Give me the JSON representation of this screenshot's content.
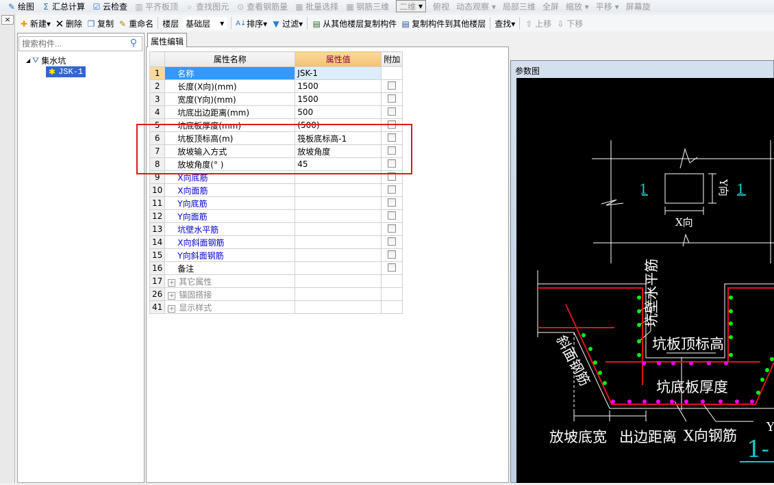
{
  "toolbar_top": {
    "items": [
      {
        "label": "绘图",
        "enabled": true
      },
      {
        "label": "汇总计算",
        "enabled": true
      },
      {
        "label": "云检查",
        "enabled": true
      },
      {
        "label": "平齐板顶",
        "enabled": false
      },
      {
        "label": "查找图元",
        "enabled": false
      },
      {
        "label": "查看钢筋量",
        "enabled": false
      },
      {
        "label": "批量选择",
        "enabled": false
      },
      {
        "label": "钢筋三维",
        "enabled": false
      }
    ],
    "view_combo": "二维",
    "view_items": [
      "俯视",
      "动态观察",
      "局部三维",
      "全屏",
      "缩放",
      "平移",
      "屏幕旋"
    ]
  },
  "toolbar": {
    "new": "新建",
    "delete": "删除",
    "copy": "复制",
    "rename": "重命名",
    "floor_label": "楼层",
    "floor_value": "基础层",
    "sort": "排序",
    "filter": "过滤",
    "copy_from": "从其他楼层复制构件",
    "copy_to": "复制构件到其他楼层",
    "find": "查找",
    "move_up": "上移",
    "move_down": "下移"
  },
  "left": {
    "search_placeholder": "搜索构件...",
    "tree_root": "集水坑",
    "tree_child": "JSK-1"
  },
  "tab": "属性编辑",
  "table": {
    "headers": [
      "属性名称",
      "属性值",
      "附加"
    ],
    "rows": [
      {
        "n": "1",
        "name": "名称",
        "value": "JSK-1",
        "style": "sel",
        "cb": false
      },
      {
        "n": "2",
        "name": "长度(X向)(mm)",
        "value": "1500",
        "cb": true
      },
      {
        "n": "3",
        "name": "宽度(Y向)(mm)",
        "value": "1500",
        "cb": true
      },
      {
        "n": "4",
        "name": "坑底出边距离(mm)",
        "value": "500",
        "cb": true
      },
      {
        "n": "5",
        "name": "坑底板厚度(mm)",
        "value": "(500)",
        "cb": true
      },
      {
        "n": "6",
        "name": "坑板顶标高(m)",
        "value": "筏板底标高-1",
        "cb": true
      },
      {
        "n": "7",
        "name": "放坡输入方式",
        "value": "放坡角度",
        "cb": true
      },
      {
        "n": "8",
        "name": "放坡角度(° )",
        "value": "45",
        "cb": true
      },
      {
        "n": "9",
        "name": "X向底筋",
        "value": "",
        "style": "blue",
        "cb": true
      },
      {
        "n": "10",
        "name": "X向面筋",
        "value": "",
        "style": "blue",
        "cb": true
      },
      {
        "n": "11",
        "name": "Y向底筋",
        "value": "",
        "style": "blue",
        "cb": true
      },
      {
        "n": "12",
        "name": "Y向面筋",
        "value": "",
        "style": "blue",
        "cb": true
      },
      {
        "n": "13",
        "name": "坑壁水平筋",
        "value": "",
        "style": "blue",
        "cb": true
      },
      {
        "n": "14",
        "name": "X向斜面钢筋",
        "value": "",
        "style": "blue",
        "cb": true
      },
      {
        "n": "15",
        "name": "Y向斜面钢筋",
        "value": "",
        "style": "blue",
        "cb": true
      },
      {
        "n": "16",
        "name": "备注",
        "value": "",
        "cb": true
      },
      {
        "n": "17",
        "name": "其它属性",
        "value": "",
        "style": "group",
        "cb": false
      },
      {
        "n": "26",
        "name": "锚固搭接",
        "value": "",
        "style": "group",
        "cb": false
      },
      {
        "n": "41",
        "name": "显示样式",
        "value": "",
        "style": "group",
        "cb": false
      }
    ]
  },
  "param": {
    "title": "参数图",
    "section_mark": "1",
    "x_dir": "X向",
    "y_dir": "Y向",
    "wall_bar": "坑壁水平筋",
    "top_elev": "坑板顶标高",
    "bottom_thk": "坑底板厚度",
    "slope_bar": "斜面钢筋",
    "slope_width": "放坡底宽",
    "edge_dist": "出边距离",
    "x_bar": "X向钢筋",
    "section_label": "1-",
    "y_partial": "Y"
  },
  "colors": {
    "red": "#e0141e",
    "cyan": "#19c8c8",
    "green": "#00ff00",
    "magenta": "#ff00ff",
    "selection": "#3399ff"
  }
}
